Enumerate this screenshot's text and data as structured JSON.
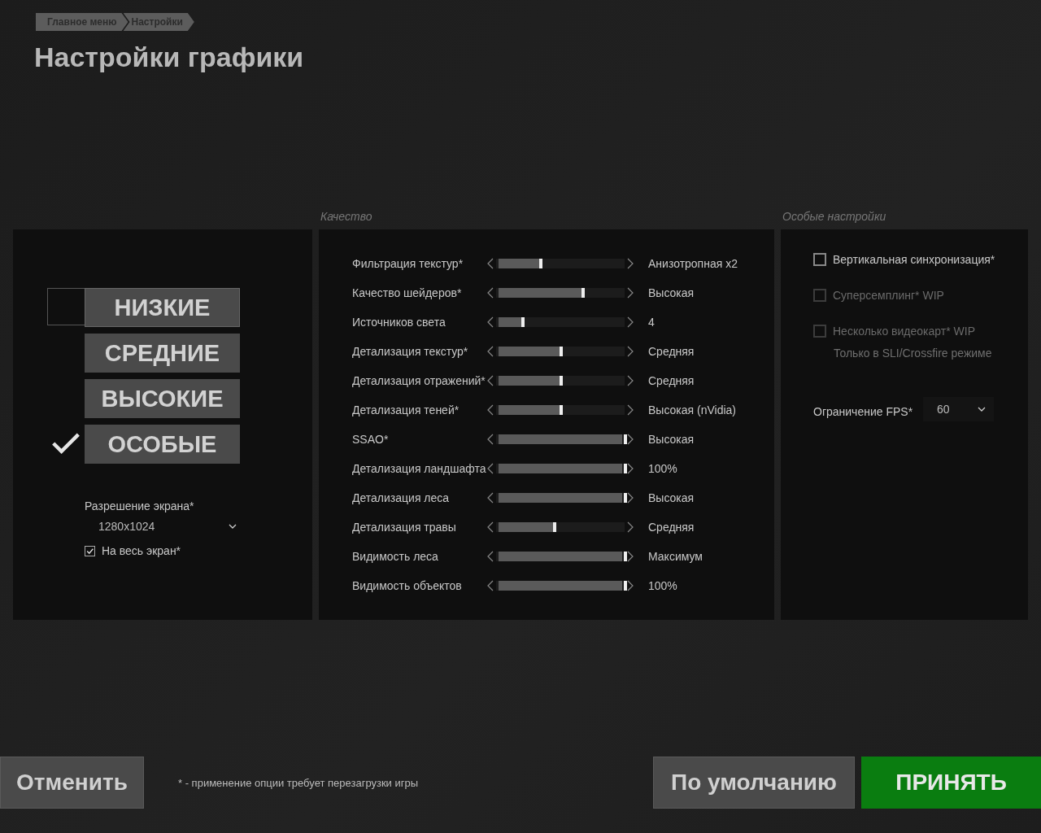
{
  "breadcrumb": [
    {
      "label": "Главное меню"
    },
    {
      "label": "Настройки"
    }
  ],
  "title": "Настройки графики",
  "presets": {
    "items": [
      {
        "label": "НИЗКИЕ",
        "selected": false,
        "hovered": true
      },
      {
        "label": "СРЕДНИЕ",
        "selected": false,
        "hovered": false
      },
      {
        "label": "ВЫСОКИЕ",
        "selected": false,
        "hovered": false
      },
      {
        "label": "ОСОБЫЕ",
        "selected": true,
        "hovered": false
      }
    ],
    "resolution_label": "Разрешение экрана*",
    "resolution_value": "1280x1024",
    "fullscreen": {
      "label": "На весь экран*",
      "checked": true
    }
  },
  "quality": {
    "heading": "Качество",
    "rows": [
      {
        "label": "Фильтрация текстур*",
        "level": 0.34,
        "value": "Анизотропная x2"
      },
      {
        "label": "Качество шейдеров*",
        "level": 0.67,
        "value": "Высокая"
      },
      {
        "label": "Источников света",
        "level": 0.2,
        "value": "4"
      },
      {
        "label": "Детализация текстур*",
        "level": 0.5,
        "value": "Средняя"
      },
      {
        "label": "Детализация отражений*",
        "level": 0.5,
        "value": "Средняя"
      },
      {
        "label": "Детализация теней*",
        "level": 0.5,
        "value": "Высокая (nVidia)"
      },
      {
        "label": "SSAO*",
        "level": 1,
        "value": "Высокая"
      },
      {
        "label": "Детализация ландшафта",
        "level": 1,
        "value": "100%"
      },
      {
        "label": "Детализация леса",
        "level": 1,
        "value": "Высокая"
      },
      {
        "label": "Детализация травы",
        "level": 0.45,
        "value": "Средняя"
      },
      {
        "label": "Видимость леса",
        "level": 1,
        "value": "Максимум"
      },
      {
        "label": "Видимость объектов",
        "level": 1,
        "value": "100%"
      }
    ]
  },
  "special": {
    "heading": "Особые настройки",
    "options": [
      {
        "label": "Вертикальная синхронизация*",
        "checked": false,
        "disabled": false
      },
      {
        "label": "Суперсемплинг*  WIP",
        "checked": false,
        "disabled": true
      },
      {
        "label": "Несколько видеокарт*  WIP",
        "checked": false,
        "disabled": true,
        "note": "Только в SLI/Crossfire режиме"
      }
    ],
    "fps_label": "Ограничение FPS*",
    "fps_value": "60"
  },
  "footer": {
    "cancel": "Отменить",
    "note": "* - применение опции требует перезагрузки игры",
    "defaults": "По умолчанию",
    "accept": "ПРИНЯТЬ"
  }
}
